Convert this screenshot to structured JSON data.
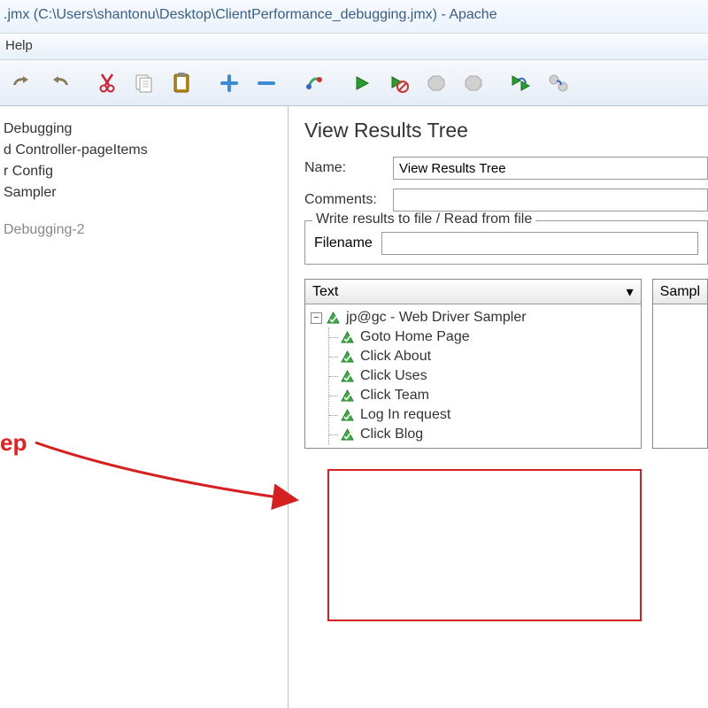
{
  "titlebar": ".jmx (C:\\Users\\shantonu\\Desktop\\ClientPerformance_debugging.jmx) - Apache",
  "menubar": {
    "help": "Help"
  },
  "left_tree": {
    "items": [
      {
        "label": "Debugging"
      },
      {
        "label": "d Controller-pageItems"
      },
      {
        "label": "r Config"
      },
      {
        "label": "Sampler"
      }
    ],
    "faded_item": "Debugging-2"
  },
  "panel": {
    "title": "View Results Tree",
    "name_label": "Name:",
    "name_value": "View Results Tree",
    "comments_label": "Comments:",
    "fieldset_legend": "Write results to file / Read from file",
    "filename_label": "Filename"
  },
  "results": {
    "dropdown_label": "Text",
    "root": "jp@gc - Web Driver Sampler",
    "children": [
      "Goto Home Page",
      "Click About",
      "Click Uses",
      "Click Team",
      "Log In request",
      "Click Blog"
    ],
    "sampler_label": "Sampl"
  },
  "annotation": "ep"
}
